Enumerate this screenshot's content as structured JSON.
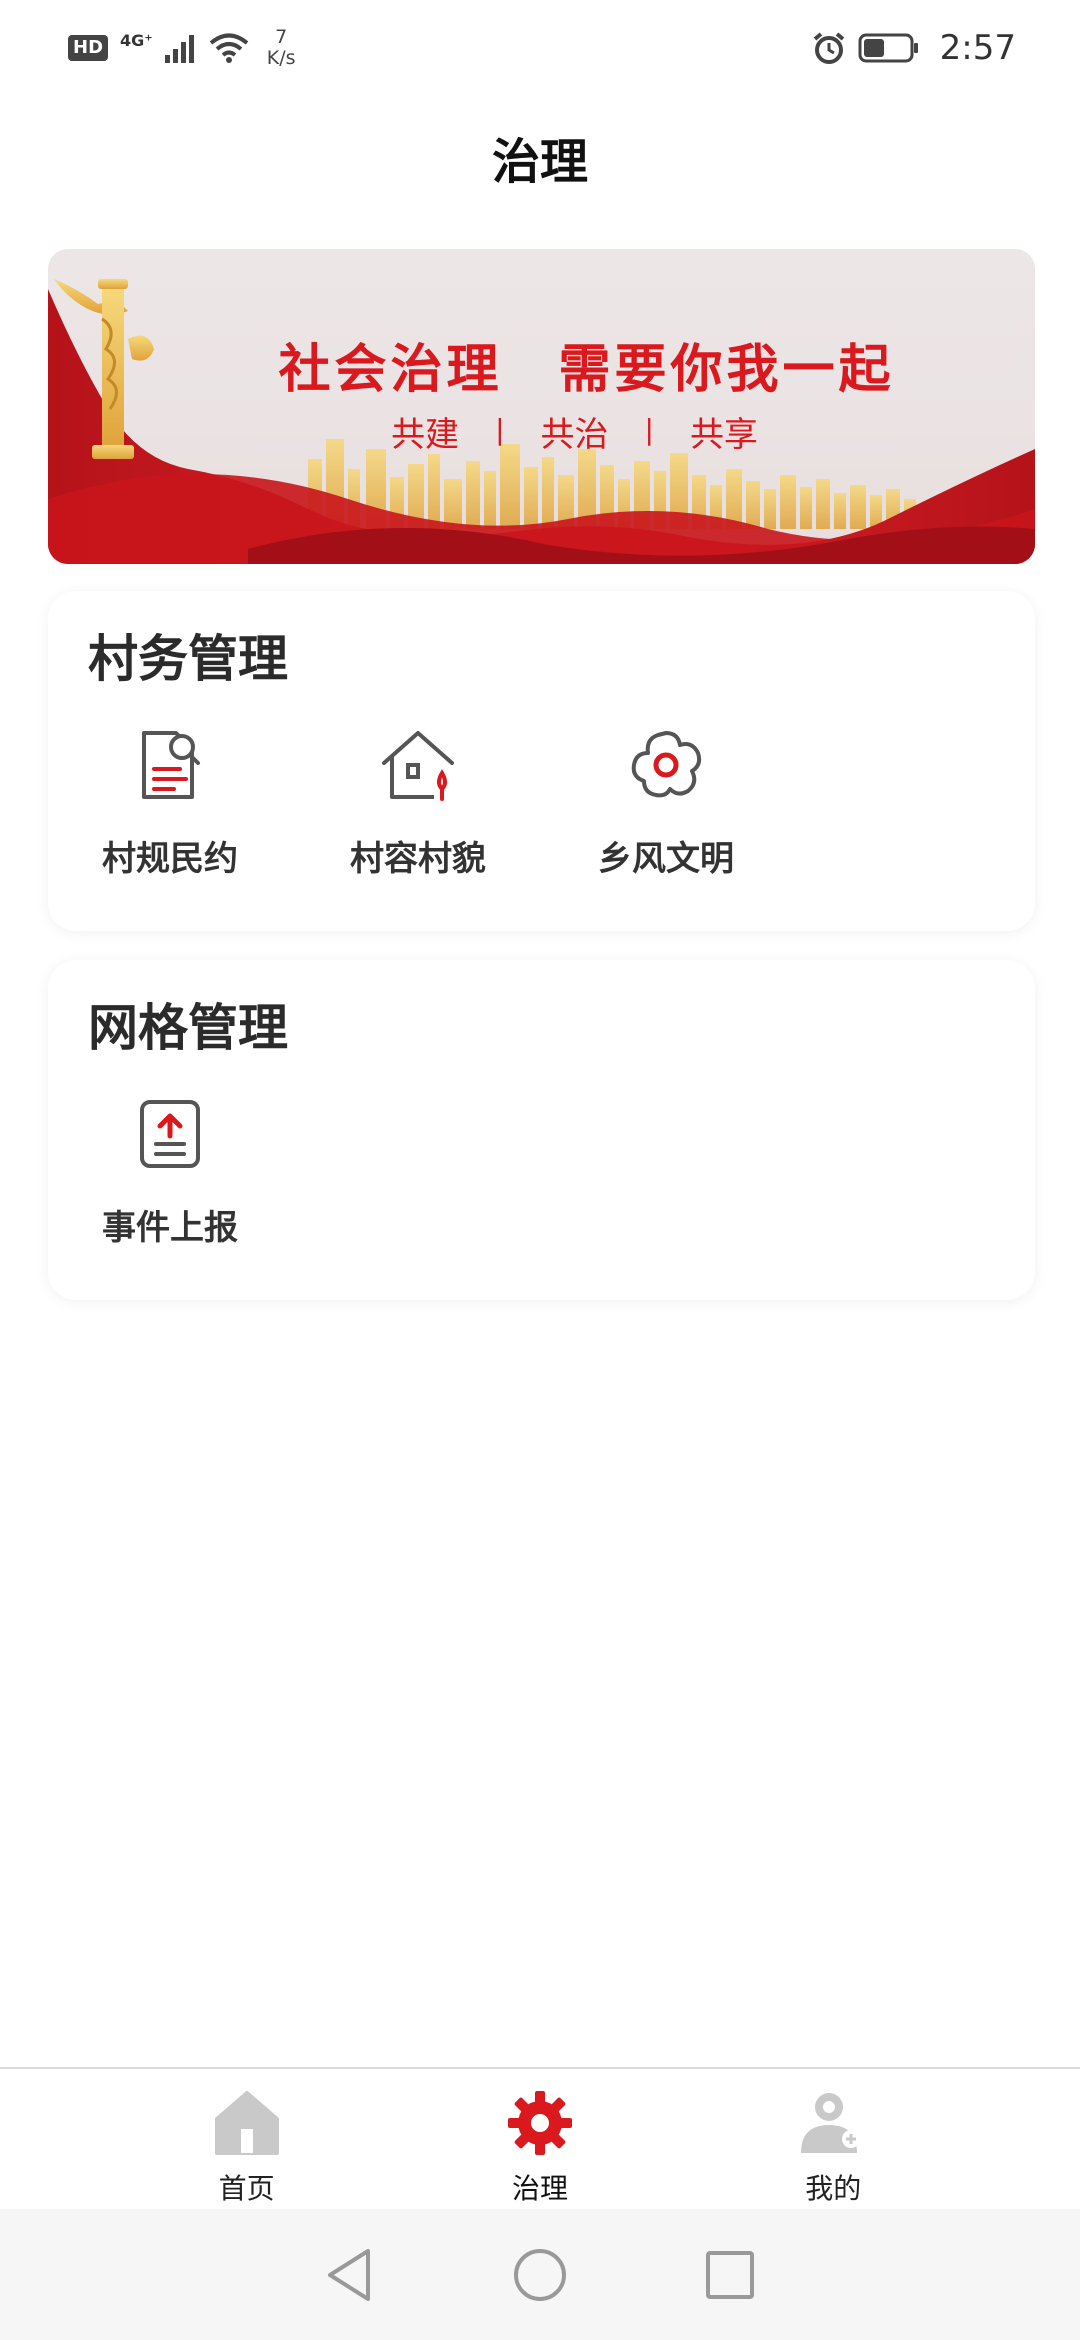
{
  "status_bar": {
    "hd": "HD",
    "network": "4G⁺",
    "speed_value": "7",
    "speed_unit": "K/s",
    "time": "2:57",
    "battery_level": 0.45
  },
  "header": {
    "title": "治理"
  },
  "banner": {
    "headline": "社会治理　需要你我一起",
    "subs": [
      "共建",
      "共治",
      "共享"
    ],
    "sep": "|"
  },
  "village_affairs": {
    "title": "村务管理",
    "items": [
      {
        "label": "村规民约",
        "icon": "document-icon"
      },
      {
        "label": "村容村貌",
        "icon": "house-icon"
      },
      {
        "label": "乡风文明",
        "icon": "flower-icon"
      }
    ]
  },
  "grid_management": {
    "title": "网格管理",
    "items": [
      {
        "label": "事件上报",
        "icon": "upload-report-icon"
      }
    ]
  },
  "bottom_nav": {
    "items": [
      {
        "label": "首页",
        "icon": "home-icon",
        "active": false
      },
      {
        "label": "治理",
        "icon": "gear-icon",
        "active": true
      },
      {
        "label": "我的",
        "icon": "user-icon",
        "active": false
      }
    ]
  },
  "colors": {
    "accent": "#d9191e",
    "inactive_icon": "#c9c9c9"
  }
}
